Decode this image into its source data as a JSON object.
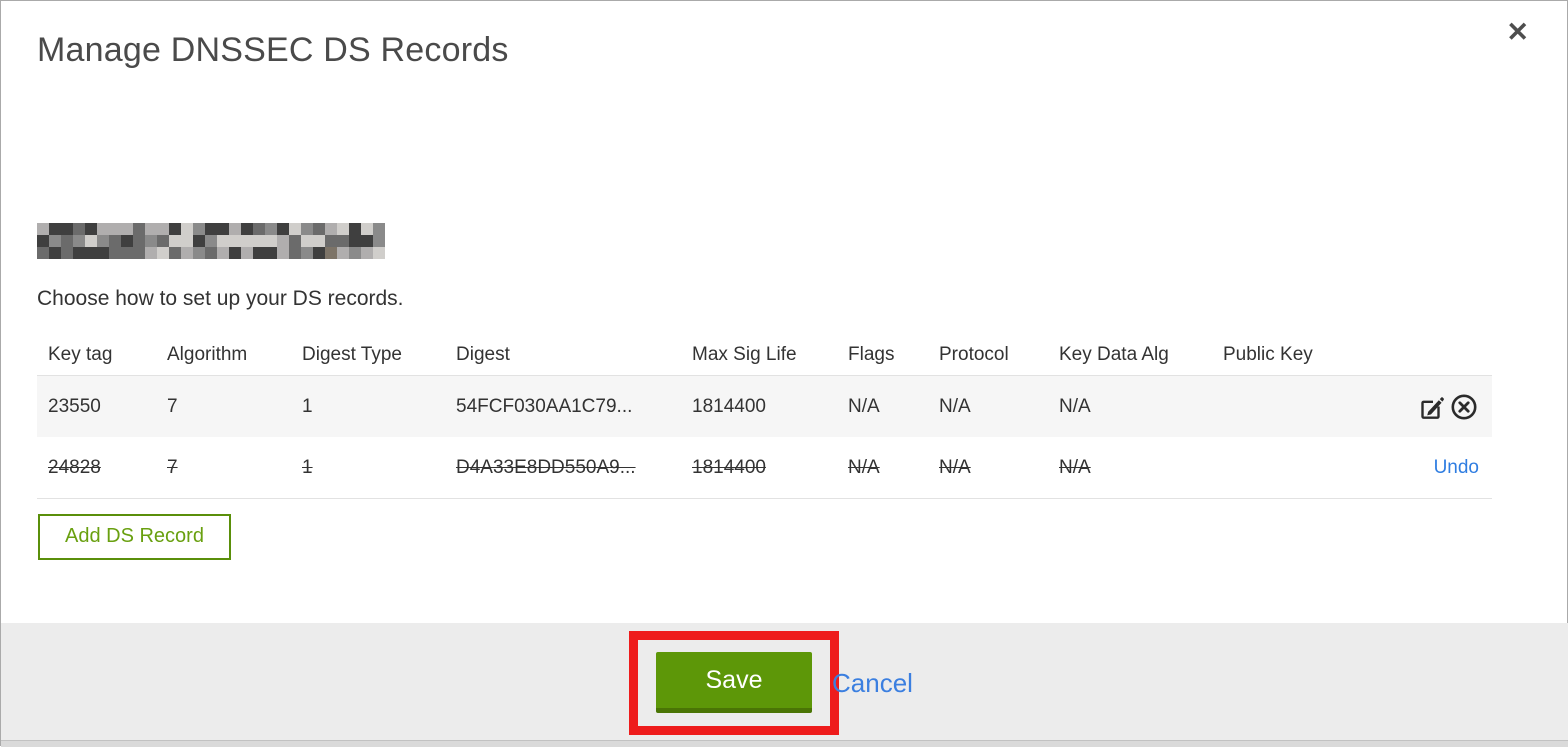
{
  "modal": {
    "title": "Manage DNSSEC DS Records",
    "close_glyph": "✕",
    "intro": "Choose how to set up your DS records.",
    "table": {
      "columns": [
        "Key tag",
        "Algorithm",
        "Digest Type",
        "Digest",
        "Max Sig Life",
        "Flags",
        "Protocol",
        "Key Data Alg",
        "Public Key"
      ],
      "rows": [
        {
          "cells": [
            "23550",
            "7",
            "1",
            "54FCF030AA1C79...",
            "1814400",
            "N/A",
            "N/A",
            "N/A",
            ""
          ],
          "struck": false,
          "actions": [
            "edit",
            "delete"
          ]
        },
        {
          "cells": [
            "24828",
            "7",
            "1",
            "D4A33E8DD550A9...",
            "1814400",
            "N/A",
            "N/A",
            "N/A",
            ""
          ],
          "struck": true,
          "undo_label": "Undo"
        }
      ]
    },
    "add_button_label": "Add DS Record",
    "footer": {
      "save_label": "Save",
      "cancel_label": "Cancel"
    }
  },
  "icons": {
    "close": "close-icon",
    "edit": "edit-record-icon",
    "delete": "delete-record-icon"
  },
  "colors": {
    "button_green": "#5d9708",
    "button_green_dark": "#4a7505",
    "outline_green": "#5a8f0a",
    "link_blue": "#2f7de1",
    "annotation_red": "#ee1c1c",
    "footer_gray": "#ececec",
    "row_gray": "#f6f6f6"
  }
}
